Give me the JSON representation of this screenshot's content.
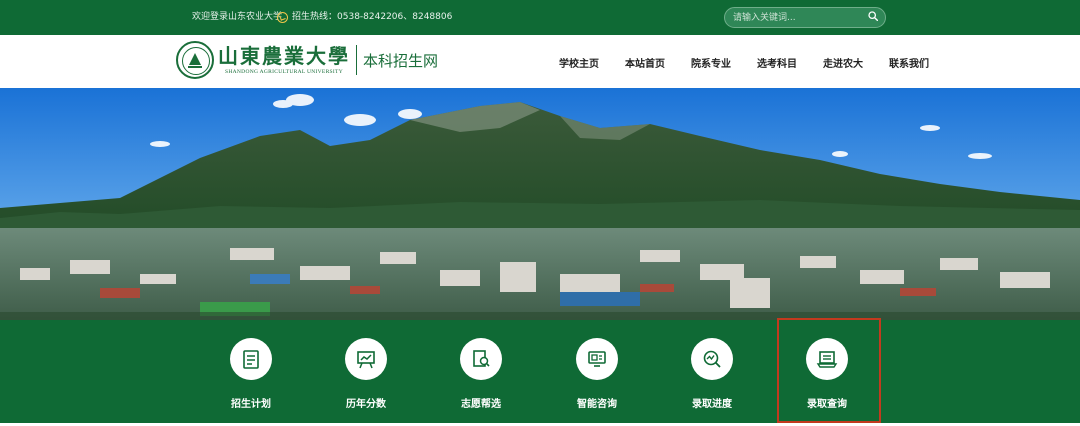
{
  "topbar": {
    "welcome": "欢迎登录山东农业大学",
    "hotline_label": "招生热线：",
    "hotline_numbers": "0538-8242206、8248806",
    "search_placeholder": "请输入关键词..."
  },
  "header": {
    "logo_cn": "山東農業大學",
    "logo_en": "SHANDONG AGRICULTURAL UNIVERSITY",
    "site_name": "本科招生网",
    "nav": [
      "学校主页",
      "本站首页",
      "院系专业",
      "选考科目",
      "走进农大",
      "联系我们"
    ]
  },
  "banner": {
    "slides": 3,
    "active_slide": 0
  },
  "quick_links": [
    {
      "label": "招生计划",
      "icon": "plan-document-icon"
    },
    {
      "label": "历年分数",
      "icon": "score-board-icon"
    },
    {
      "label": "志愿帮选",
      "icon": "search-document-icon"
    },
    {
      "label": "智能咨询",
      "icon": "smart-consult-icon"
    },
    {
      "label": "录取进度",
      "icon": "progress-chart-icon"
    },
    {
      "label": "录取查询",
      "icon": "admission-query-icon",
      "highlighted": true
    }
  ],
  "colors": {
    "brand_green": "#0f6a35",
    "highlight_red": "#c23a1e"
  }
}
